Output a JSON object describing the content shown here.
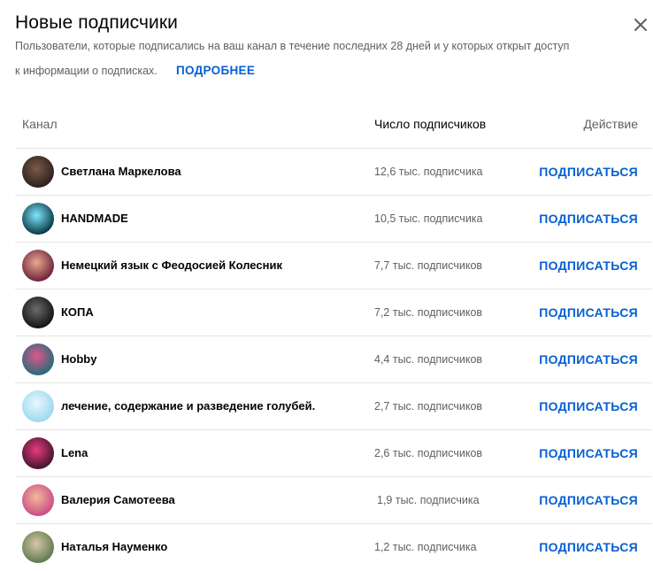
{
  "dialog": {
    "title": "Новые подписчики",
    "description_line1": "Пользователи, которые подписались на ваш канал в течение последних 28 дней и у которых открыт доступ",
    "description_line2": "к информации о подписках.",
    "more_link": "ПОДРОБНЕЕ",
    "close_icon": "close-icon"
  },
  "table": {
    "headers": {
      "channel": "Канал",
      "subscribers": "Число подписчиков",
      "action": "Действие"
    },
    "rows": [
      {
        "name": "Светлана Маркелова",
        "subscribers": "12,6 тыс. подписчика",
        "action": "ПОДПИСАТЬСЯ",
        "avatar_colors": [
          "#7a5a48",
          "#2b1f1a"
        ]
      },
      {
        "name": "HANDMADE",
        "subscribers": "10,5 тыс. подписчика",
        "action": "ПОДПИСАТЬСЯ",
        "avatar_colors": [
          "#7fe8ff",
          "#05343f"
        ]
      },
      {
        "name": "Немецкий язык с Феодосией Колесник",
        "subscribers": "7,7 тыс. подписчиков",
        "action": "ПОДПИСАТЬСЯ",
        "avatar_colors": [
          "#e9a98f",
          "#6a1f3a"
        ]
      },
      {
        "name": "КОПА",
        "subscribers": "7,2 тыс. подписчиков",
        "action": "ПОДПИСАТЬСЯ",
        "avatar_colors": [
          "#6b6b6b",
          "#111111"
        ]
      },
      {
        "name": "Hobby",
        "subscribers": "4,4 тыс. подписчиков",
        "action": "ПОДПИСАТЬСЯ",
        "avatar_colors": [
          "#e0568a",
          "#1d6e7a"
        ]
      },
      {
        "name": "лечение, содержание и разведение голубей.",
        "subscribers": "2,7 тыс. подписчиков",
        "action": "ПОДПИСАТЬСЯ",
        "avatar_colors": [
          "#eaf7fd",
          "#9bd7f0"
        ]
      },
      {
        "name": "Lena",
        "subscribers": "2,6 тыс. подписчиков",
        "action": "ПОДПИСАТЬСЯ",
        "avatar_colors": [
          "#e93a7a",
          "#3c1530"
        ]
      },
      {
        "name": "Валерия Самотеева",
        "subscribers": "1,9 тыс. подписчика",
        "action": "ПОДПИСАТЬСЯ",
        "avatar_colors": [
          "#f4b99a",
          "#c84a86"
        ]
      },
      {
        "name": "Наталья Науменко",
        "subscribers": "1,2 тыс. подписчика",
        "action": "ПОДПИСАТЬСЯ",
        "avatar_colors": [
          "#d9c6a8",
          "#5a7a4a"
        ]
      }
    ]
  },
  "colors": {
    "accent_link": "#065fd4",
    "text_primary": "#030303",
    "text_secondary": "#606060",
    "divider": "#e5e5e5"
  }
}
